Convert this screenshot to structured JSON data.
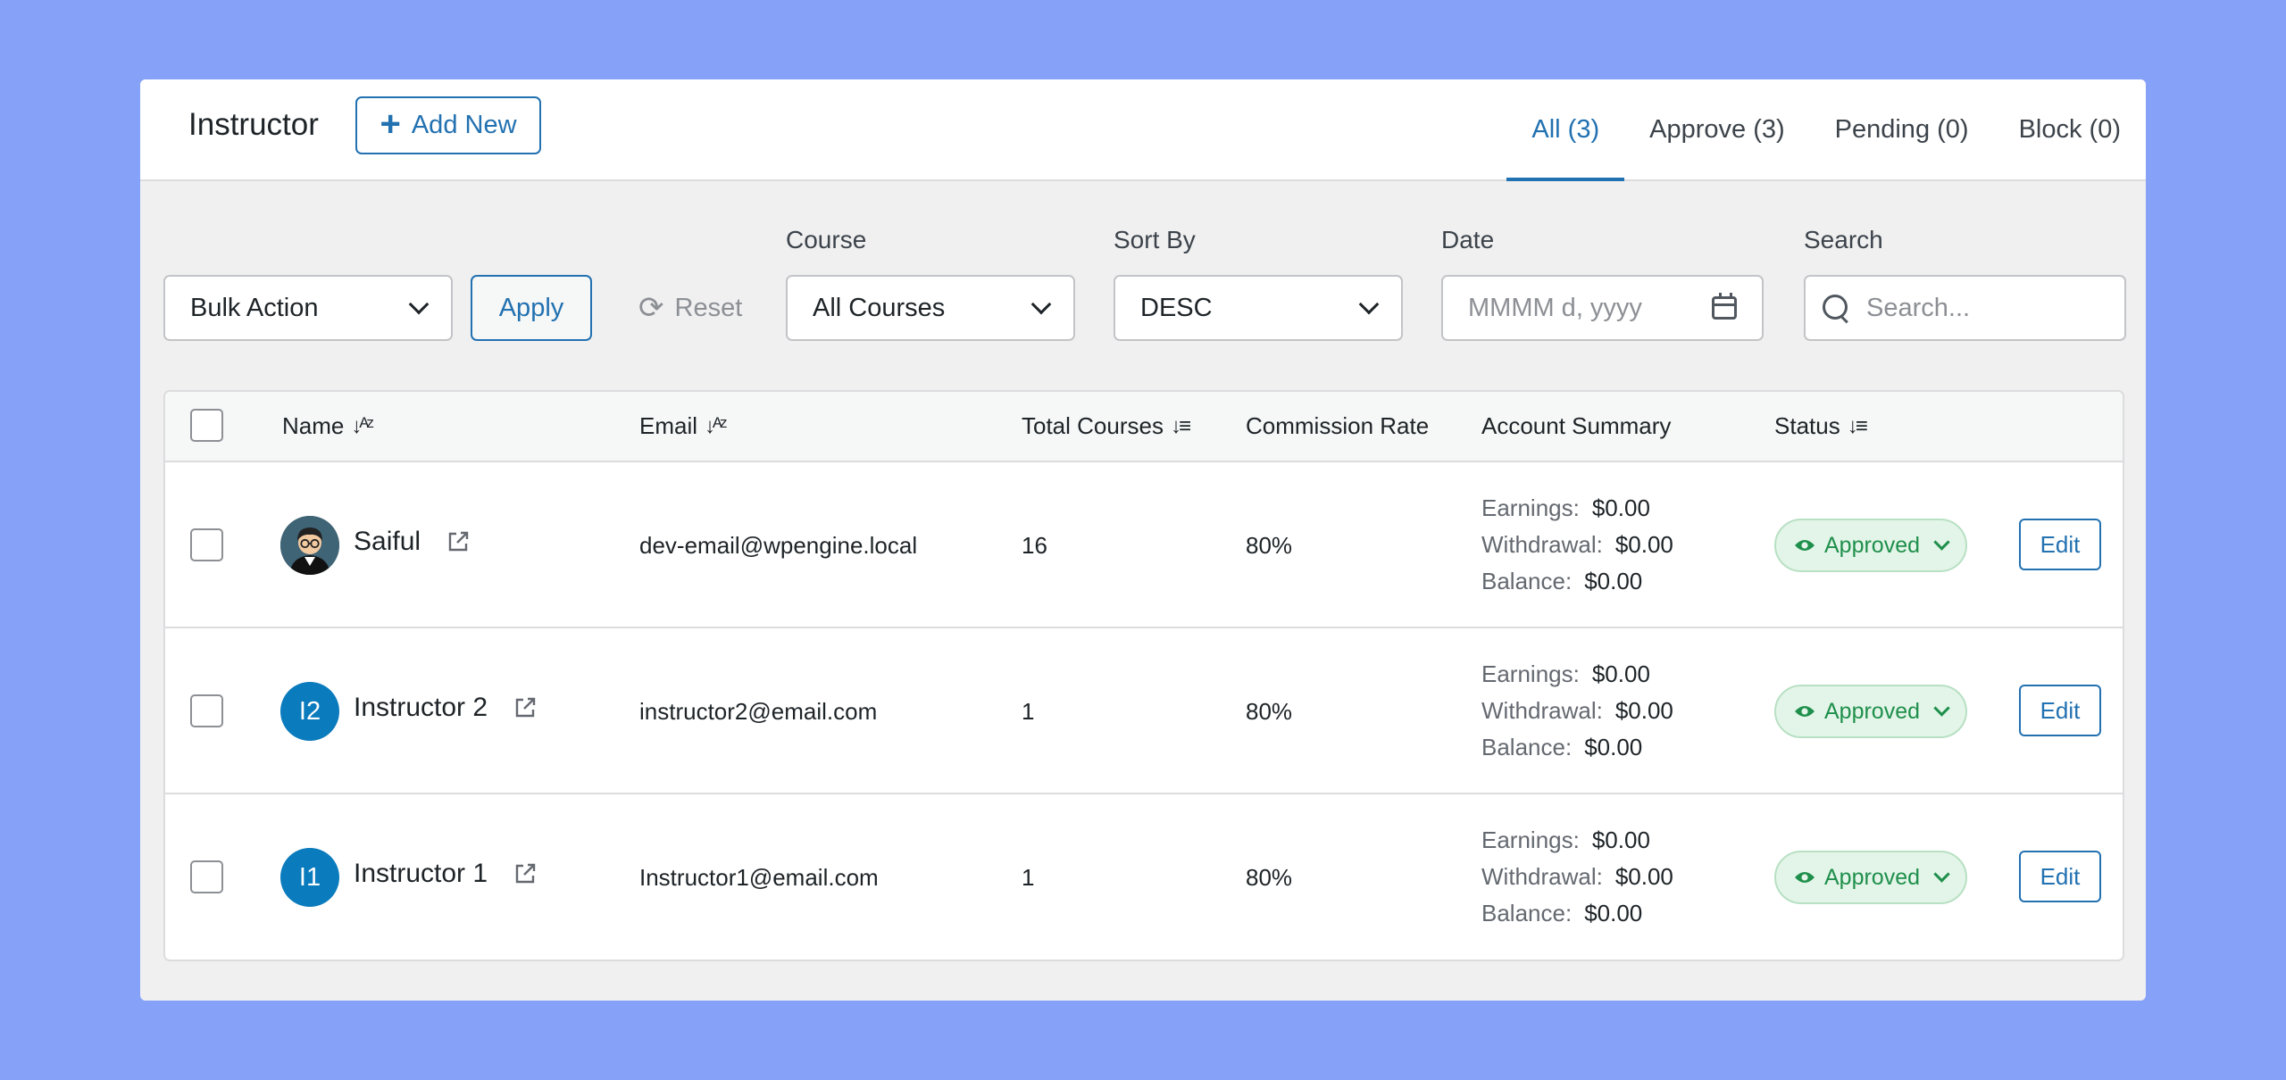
{
  "header": {
    "title": "Instructor",
    "add_new_label": "Add New",
    "tabs": [
      {
        "label": "All (3)"
      },
      {
        "label": "Approve (3)"
      },
      {
        "label": "Pending (0)"
      },
      {
        "label": "Block (0)"
      }
    ]
  },
  "filters": {
    "bulk_action": "Bulk Action",
    "apply_label": "Apply",
    "reset_label": "Reset",
    "course_label": "Course",
    "course_value": "All Courses",
    "sort_label": "Sort By",
    "sort_value": "DESC",
    "date_label": "Date",
    "date_placeholder": "MMMM d, yyyy",
    "search_label": "Search",
    "search_placeholder": "Search..."
  },
  "table": {
    "columns": {
      "name": "Name",
      "email": "Email",
      "total_courses": "Total Courses",
      "commission": "Commission Rate",
      "summary": "Account Summary",
      "status": "Status"
    },
    "summary_labels": {
      "earnings": "Earnings:",
      "withdrawal": "Withdrawal:",
      "balance": "Balance:"
    },
    "rows": [
      {
        "initials": "",
        "name": "Saiful",
        "email": "dev-email@wpengine.local",
        "courses": "16",
        "commission": "80%",
        "earnings": "$0.00",
        "withdrawal": "$0.00",
        "balance": "$0.00",
        "status": "Approved",
        "edit": "Edit"
      },
      {
        "initials": "I2",
        "name": "Instructor 2",
        "email": "instructor2@email.com",
        "courses": "1",
        "commission": "80%",
        "earnings": "$0.00",
        "withdrawal": "$0.00",
        "balance": "$0.00",
        "status": "Approved",
        "edit": "Edit"
      },
      {
        "initials": "I1",
        "name": "Instructor 1",
        "email": "Instructor1@email.com",
        "courses": "1",
        "commission": "80%",
        "earnings": "$0.00",
        "withdrawal": "$0.00",
        "balance": "$0.00",
        "status": "Approved",
        "edit": "Edit"
      }
    ]
  },
  "colors": {
    "background": "#86a1f8",
    "accent": "#2271b1",
    "approved": "#1f8f4c"
  }
}
